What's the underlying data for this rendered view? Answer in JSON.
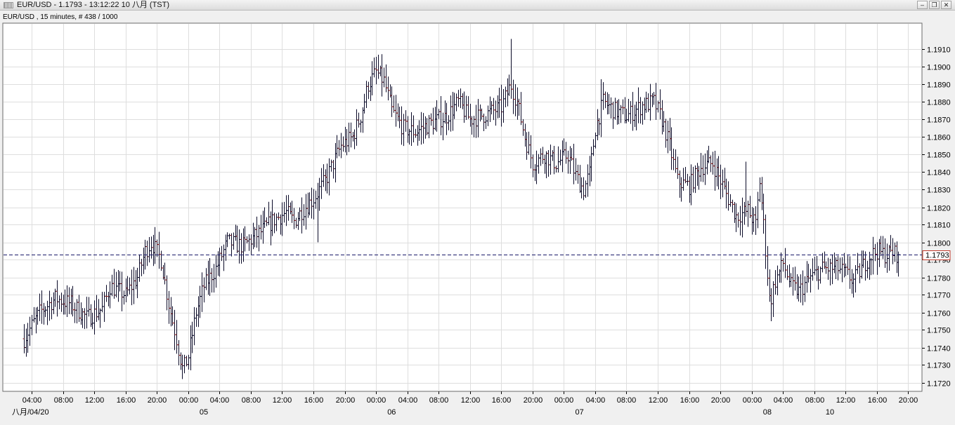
{
  "window": {
    "title": "EUR/USD - 1.1793 - 13:12:22  10 八月 (TST)",
    "minimize_label": "–",
    "restore_label": "❐",
    "close_label": "✕"
  },
  "chart_info": "EUR/USD , 15 minutes, # 438 / 1000",
  "price_label": "1.1793",
  "colors": {
    "grid": "#dedede",
    "bar": "#0a0a28",
    "bar_down": "#8b1a1a",
    "current_line": "#1a1a6a",
    "price_box": "#c0392b",
    "background": "#ffffff"
  },
  "chart_data": {
    "type": "bar",
    "symbol": "EUR/USD",
    "timeframe": "15 minutes",
    "current_price": 1.1793,
    "ylim": [
      1.1715,
      1.1925
    ],
    "y_ticks": [
      "1.1720",
      "1.1730",
      "1.1740",
      "1.1750",
      "1.1760",
      "1.1770",
      "1.1780",
      "1.1790",
      "1.1800",
      "1.1810",
      "1.1820",
      "1.1830",
      "1.1840",
      "1.1850",
      "1.1860",
      "1.1870",
      "1.1880",
      "1.1890",
      "1.1900",
      "1.1910"
    ],
    "x_tick_labels": [
      "04:00",
      "08:00",
      "12:00",
      "16:00",
      "20:00",
      "00:00",
      "04:00",
      "08:00",
      "12:00",
      "16:00",
      "20:00",
      "00:00",
      "04:00",
      "08:00",
      "12:00",
      "16:00",
      "20:00",
      "00:00",
      "04:00",
      "08:00",
      "12:00",
      "16:00",
      "20:00",
      "00:00",
      "04:00",
      "08:00",
      "12:00",
      "16:00",
      "20:00"
    ],
    "date_labels": [
      {
        "label": "八月/04/20",
        "after_tick": -1
      },
      {
        "label": "05",
        "after_tick": 5
      },
      {
        "label": "06",
        "after_tick": 11
      },
      {
        "label": "07",
        "after_tick": 17
      },
      {
        "label": "08",
        "after_tick": 23
      },
      {
        "label": "10",
        "after_tick": 25
      }
    ],
    "price_path": [
      {
        "t": 0,
        "p": 1.1745
      },
      {
        "t": 2,
        "p": 1.176
      },
      {
        "t": 4,
        "p": 1.1768
      },
      {
        "t": 6,
        "p": 1.1765
      },
      {
        "t": 8,
        "p": 1.1757
      },
      {
        "t": 10,
        "p": 1.1762
      },
      {
        "t": 11,
        "p": 1.1775
      },
      {
        "t": 13,
        "p": 1.177
      },
      {
        "t": 14.5,
        "p": 1.178
      },
      {
        "t": 15.5,
        "p": 1.1795
      },
      {
        "t": 16.3,
        "p": 1.18
      },
      {
        "t": 17.5,
        "p": 1.179
      },
      {
        "t": 18.5,
        "p": 1.1765
      },
      {
        "t": 19.5,
        "p": 1.1745
      },
      {
        "t": 20.3,
        "p": 1.1727
      },
      {
        "t": 21,
        "p": 1.1735
      },
      {
        "t": 22,
        "p": 1.176
      },
      {
        "t": 23,
        "p": 1.1775
      },
      {
        "t": 24.5,
        "p": 1.1785
      },
      {
        "t": 26,
        "p": 1.18
      },
      {
        "t": 28,
        "p": 1.1798
      },
      {
        "t": 30,
        "p": 1.1805
      },
      {
        "t": 32,
        "p": 1.1813
      },
      {
        "t": 33.5,
        "p": 1.1817
      },
      {
        "t": 34.5,
        "p": 1.1812
      },
      {
        "t": 35.5,
        "p": 1.1818
      },
      {
        "t": 37,
        "p": 1.1825
      },
      {
        "t": 38.5,
        "p": 1.1835
      },
      {
        "t": 39.5,
        "p": 1.1845
      },
      {
        "t": 40.5,
        "p": 1.1855
      },
      {
        "t": 42,
        "p": 1.186
      },
      {
        "t": 43,
        "p": 1.1872
      },
      {
        "t": 44,
        "p": 1.189
      },
      {
        "t": 45,
        "p": 1.1897
      },
      {
        "t": 46,
        "p": 1.1892
      },
      {
        "t": 47,
        "p": 1.1875
      },
      {
        "t": 48.5,
        "p": 1.1865
      },
      {
        "t": 50,
        "p": 1.1863
      },
      {
        "t": 52,
        "p": 1.1868
      },
      {
        "t": 54,
        "p": 1.1872
      },
      {
        "t": 55.5,
        "p": 1.188
      },
      {
        "t": 57,
        "p": 1.187
      },
      {
        "t": 59,
        "p": 1.1873
      },
      {
        "t": 61,
        "p": 1.1877
      },
      {
        "t": 62.2,
        "p": 1.189
      },
      {
        "t": 63,
        "p": 1.188
      },
      {
        "t": 64,
        "p": 1.186
      },
      {
        "t": 65,
        "p": 1.1845
      },
      {
        "t": 66.5,
        "p": 1.185
      },
      {
        "t": 68,
        "p": 1.1845
      },
      {
        "t": 69.5,
        "p": 1.185
      },
      {
        "t": 70.5,
        "p": 1.1838
      },
      {
        "t": 71.5,
        "p": 1.183
      },
      {
        "t": 72.3,
        "p": 1.184
      },
      {
        "t": 73,
        "p": 1.1865
      },
      {
        "t": 74,
        "p": 1.188
      },
      {
        "t": 75.5,
        "p": 1.1875
      },
      {
        "t": 77,
        "p": 1.1872
      },
      {
        "t": 79,
        "p": 1.1878
      },
      {
        "t": 80.5,
        "p": 1.188
      },
      {
        "t": 81.5,
        "p": 1.187
      },
      {
        "t": 82.5,
        "p": 1.1855
      },
      {
        "t": 83.5,
        "p": 1.1835
      },
      {
        "t": 85,
        "p": 1.1832
      },
      {
        "t": 86.5,
        "p": 1.1843
      },
      {
        "t": 88,
        "p": 1.1845
      },
      {
        "t": 89.5,
        "p": 1.183
      },
      {
        "t": 91,
        "p": 1.1815
      },
      {
        "t": 92.5,
        "p": 1.1818
      },
      {
        "t": 93.5,
        "p": 1.181
      },
      {
        "t": 94,
        "p": 1.1835
      },
      {
        "t": 94.5,
        "p": 1.181
      },
      {
        "t": 95.3,
        "p": 1.1765
      },
      {
        "t": 96,
        "p": 1.1778
      },
      {
        "t": 97,
        "p": 1.1788
      },
      {
        "t": 98,
        "p": 1.1775
      },
      {
        "t": 99,
        "p": 1.1772
      },
      {
        "t": 100.5,
        "p": 1.178
      },
      {
        "t": 102,
        "p": 1.1785
      },
      {
        "t": 104,
        "p": 1.1785
      },
      {
        "t": 105,
        "p": 1.1782
      },
      {
        "t": 106,
        "p": 1.1778
      },
      {
        "t": 107,
        "p": 1.1785
      },
      {
        "t": 108,
        "p": 1.1792
      },
      {
        "t": 109,
        "p": 1.1795
      },
      {
        "t": 110,
        "p": 1.1793
      },
      {
        "t": 111,
        "p": 1.1794
      },
      {
        "t": 111.8,
        "p": 1.1793
      }
    ],
    "spikes": [
      {
        "t": 16.1,
        "high": 1.1803
      },
      {
        "t": 17.3,
        "high": 1.1806
      },
      {
        "t": 20.2,
        "low": 1.1722
      },
      {
        "t": 45.2,
        "high": 1.1905
      },
      {
        "t": 62.2,
        "high": 1.1916
      },
      {
        "t": 73.8,
        "high": 1.1893
      },
      {
        "t": 92.3,
        "high": 1.1846
      },
      {
        "t": 95.5,
        "low": 1.1755
      },
      {
        "t": 99.2,
        "low": 1.1766
      },
      {
        "t": 90.5,
        "low": 1.1819
      },
      {
        "t": 37.5,
        "low": 1.18
      },
      {
        "t": 49.5,
        "low": 1.1855
      }
    ]
  }
}
